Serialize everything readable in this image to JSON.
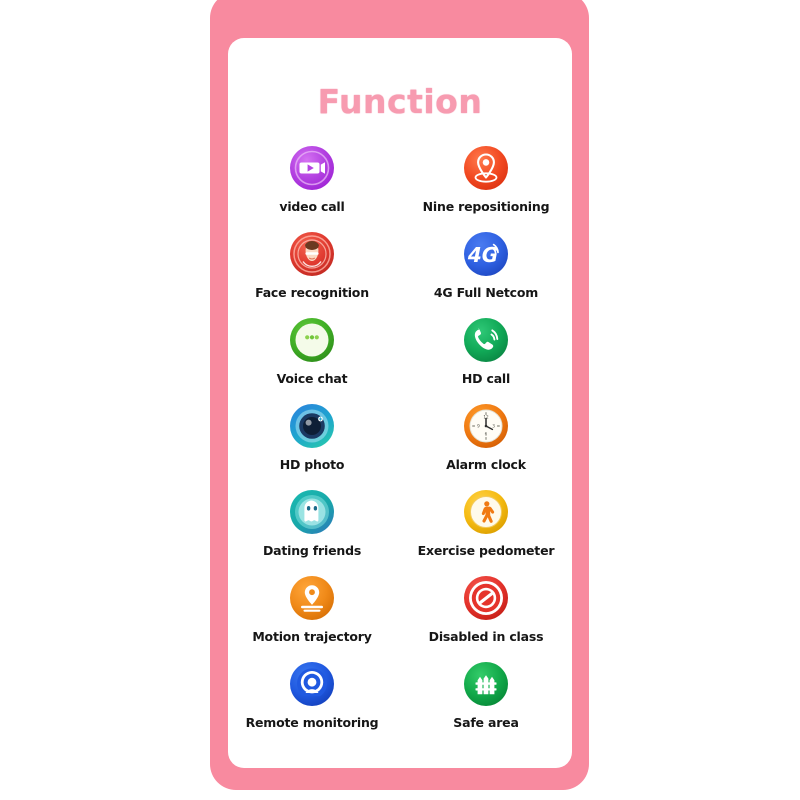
{
  "frame": {
    "border_color": "#f88a9f",
    "card_color": "#ffffff"
  },
  "header": {
    "title": "Function",
    "title_color": "#f79bb0"
  },
  "grid": {
    "columns": 2,
    "rows": [
      [
        {
          "label": "video call",
          "icon": "video-camera-icon",
          "color": "#b44ae0"
        },
        {
          "label": "Nine repositioning",
          "icon": "location-pin-icon",
          "color": "#f0472a"
        }
      ],
      [
        {
          "label": "Face recognition",
          "icon": "face-scan-icon",
          "color": "#e23b33"
        },
        {
          "label": "4G Full Netcom",
          "icon": "four-g-signal-icon",
          "color": "#2f63e0"
        }
      ],
      [
        {
          "label": "Voice chat",
          "icon": "speech-bubble-icon",
          "color": "#3dae2b"
        },
        {
          "label": "HD call",
          "icon": "phone-ring-icon",
          "color": "#12a85a"
        }
      ],
      [
        {
          "label": "HD photo",
          "icon": "camera-lens-icon",
          "color": "#2b8fd6"
        },
        {
          "label": "Alarm clock",
          "icon": "alarm-clock-icon",
          "color": "#f07818"
        }
      ],
      [
        {
          "label": "Dating friends",
          "icon": "ghost-avatar-icon",
          "color": "#1aa9a4"
        },
        {
          "label": "Exercise pedometer",
          "icon": "walking-person-icon",
          "color": "#f2bb15"
        }
      ],
      [
        {
          "label": "Motion trajectory",
          "icon": "motion-path-icon",
          "color": "#f08a19"
        },
        {
          "label": "Disabled in class",
          "icon": "prohibited-sign-icon",
          "color": "#e8322c"
        }
      ],
      [
        {
          "label": "Remote monitoring",
          "icon": "webcam-icon",
          "color": "#1f5fe0"
        },
        {
          "label": "Safe area",
          "icon": "fence-icon",
          "color": "#18a94a"
        }
      ]
    ]
  }
}
